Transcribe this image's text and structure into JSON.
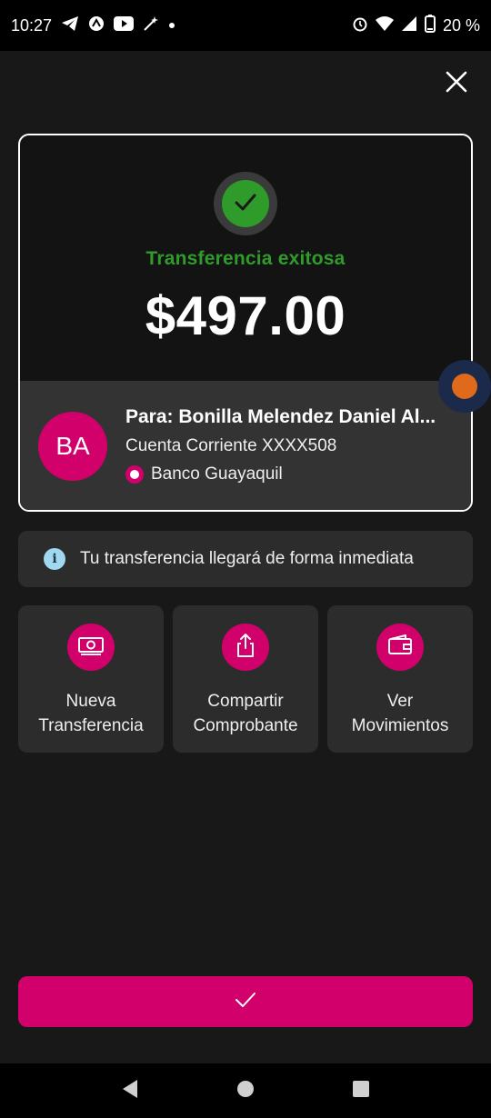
{
  "status_bar": {
    "time": "10:27",
    "battery": "20 %",
    "left_icons": [
      "telegram-icon",
      "app-notification-icon",
      "youtube-icon",
      "magic-wand-icon",
      "dot-icon"
    ],
    "right_icons": [
      "alarm-icon",
      "wifi-icon",
      "signal-icon",
      "battery-icon"
    ]
  },
  "receipt": {
    "status": "Transferencia exitosa",
    "amount": "$497.00",
    "recipient": {
      "initials": "BA",
      "name": "Para: Bonilla Melendez Daniel Al...",
      "account": "Cuenta Corriente XXXX508",
      "bank": "Banco Guayaquil"
    }
  },
  "info": {
    "message": "Tu transferencia llegará de forma inmediata"
  },
  "actions": [
    {
      "label": "Nueva\nTransferencia",
      "icon": "money-icon"
    },
    {
      "label": "Compartir\nComprobante",
      "icon": "share-icon"
    },
    {
      "label": "Ver\nMovimientos",
      "icon": "wallet-icon"
    }
  ],
  "colors": {
    "accent": "#d1006a",
    "success": "#2f9b2b",
    "background": "#181818",
    "card": "#2c2c2c"
  }
}
